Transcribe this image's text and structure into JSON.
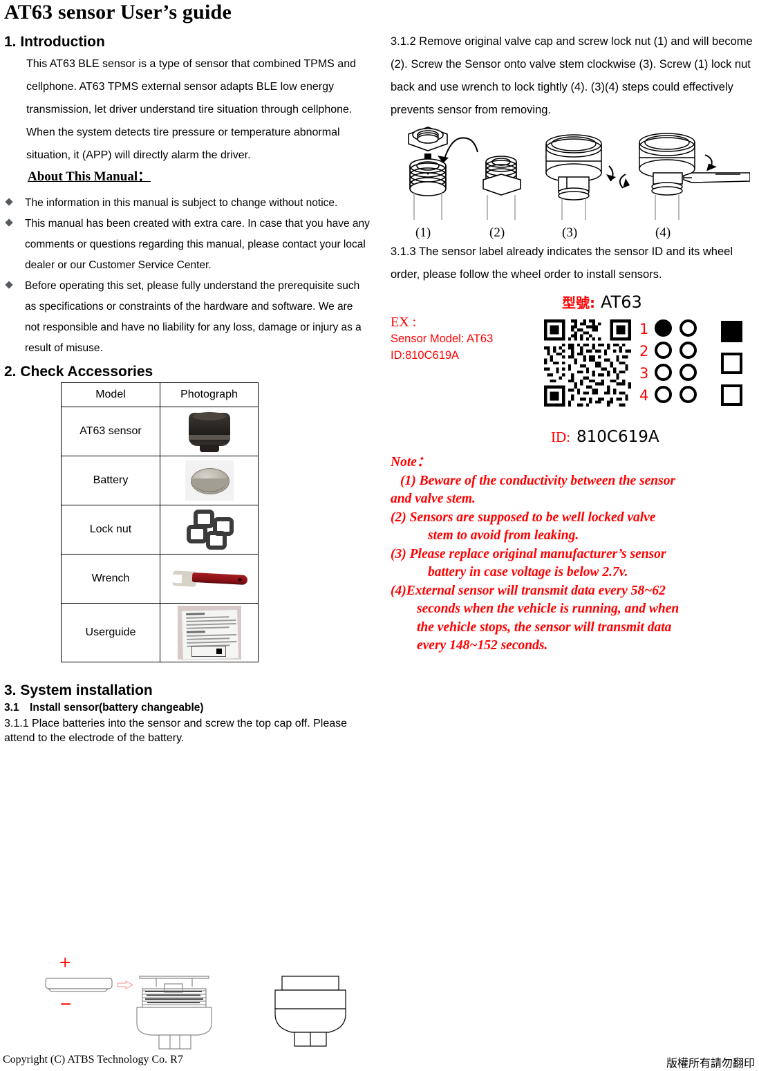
{
  "document": {
    "title": "AT63 sensor User’s guide"
  },
  "sections": {
    "introduction": {
      "heading": "1. Introduction",
      "paragraph": "This AT63 BLE sensor is a type of sensor that combined TPMS and cellphone. AT63 TPMS external sensor adapts BLE low energy transmission, let driver understand tire situation through cellphone. When the system detects tire pressure or temperature abnormal situation, it (APP) will directly alarm the driver.",
      "about_heading": "About This Manual：",
      "bullets": [
        "The information in this manual is subject to change without notice.",
        "This manual has been created with extra care. In case that you have any comments or questions regarding this manual, please contact your local dealer or our Customer Service Center.",
        "Before operating this set, please fully understand the prerequisite such as specifications or constraints of the hardware and software. We are not responsible and have no liability for any loss, damage or injury as a result of misuse."
      ]
    },
    "accessories": {
      "heading": "2. Check Accessories",
      "columns": [
        "Model",
        "Photograph"
      ],
      "rows": [
        {
          "model": "AT63 sensor",
          "photo": "sensor-photo"
        },
        {
          "model": "Battery",
          "photo": "battery-photo"
        },
        {
          "model": "Lock nut",
          "photo": "locknut-photo"
        },
        {
          "model": "Wrench",
          "photo": "wrench-photo"
        },
        {
          "model": "Userguide",
          "photo": "userguide-photo"
        }
      ]
    },
    "installation": {
      "heading": "3. System installation",
      "sub_heading": "3.1 Install sensor(battery changeable)",
      "step_3_1_1": "3.1.1 Place batteries into the sensor and screw the top cap off. Please attend to the electrode of the battery.",
      "battery_polarity": {
        "positive": "+",
        "negative": "−"
      },
      "step_3_1_2": "3.1.2 Remove original valve cap and screw lock nut (1) and will become (2). Screw the Sensor onto valve stem clockwise (3). Screw (1) lock nut back and use wrench to lock tightly (4). (3)(4) steps could effectively prevents sensor from removing.",
      "valve_figure_captions": [
        "(1)",
        "(2)",
        "(3)",
        "(4)"
      ],
      "step_3_1_3": "3.1.3 The sensor label already indicates the sensor ID and its wheel order, please follow the wheel order to install sensors."
    },
    "label_example": {
      "ex_title": "EX :",
      "ex_model_line": "Sensor Model: AT63",
      "ex_id_line": "ID:810C619A",
      "model_key": "型號:",
      "model_value": "AT63",
      "id_key": "ID:",
      "id_value": "810C619A",
      "wheel_numbers": [
        "1",
        "2",
        "3",
        "4"
      ],
      "wheel_marked_row": 1,
      "square_marked_index": 0,
      "accent_color": "#ff0000"
    },
    "note": {
      "heading": "Note：",
      "items": [
        "(1) Beware of the conductivity between the sensor and valve stem.",
        "(2) Sensors are supposed to be well locked valve stem to avoid from leaking.",
        "(3) Please replace original manufacturer’s sensor battery in case voltage is below 2.7v.",
        "(4)External sensor will transmit data every 58~62 seconds when the vehicle is running, and when the vehicle stops, the sensor will transmit data every 148~152 seconds."
      ],
      "lines": {
        "n1a": "(1) Beware of the conductivity between the sensor",
        "n1b": "and valve stem.",
        "n2a": "(2) Sensors are supposed to be well locked valve",
        "n2b": "stem to avoid from leaking.",
        "n3a": "(3) Please replace original manufacturer’s sensor",
        "n3b": "battery in case voltage is below 2.7v.",
        "n4a": "(4)External sensor will transmit data every 58~62",
        "n4b": "seconds when the vehicle is running, and when",
        "n4c": "the vehicle stops, the sensor will transmit data",
        "n4d": "every 148~152 seconds."
      }
    }
  },
  "footer": {
    "copyright": "Copyright (C) ATBS Technology Co. R7",
    "notice_zh": "版權所有請勿翻印"
  }
}
